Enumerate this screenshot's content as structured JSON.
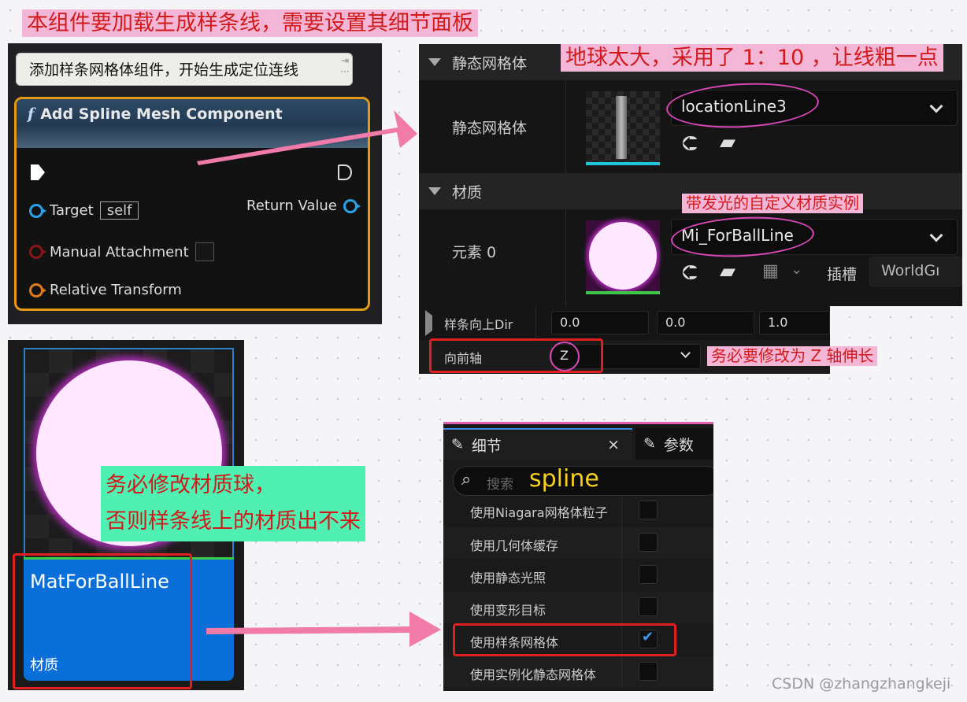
{
  "notes": {
    "top_left": "本组件要加载生成样条线，需要设置其细节面板",
    "top_right": "地球太大，采用了 1：10 ，让线粗一点",
    "material_instance": "带发光的自定义材质实例",
    "forward_axis": "务必要修改为 Z 轴伸长",
    "material_ball_line1": "务必修改材质球，",
    "material_ball_line2": "否则样条线上的材质出不来"
  },
  "blueprint": {
    "comment": "添加样条网格体组件，开始生成定位连线",
    "node_title": "Add Spline Mesh Component",
    "pins": {
      "target": "Target",
      "target_value": "self",
      "manual_attachment": "Manual Attachment",
      "relative_transform": "Relative Transform",
      "return_value": "Return Value"
    }
  },
  "static_mesh_panel": {
    "section_static_mesh": "静态网格体",
    "row_static_mesh": "静态网格体",
    "mesh_value": "locationLine3",
    "section_material": "材质",
    "row_element": "元素 0",
    "material_value": "Mi_ForBallLine",
    "slot_label": "插槽",
    "slot_value": "WorldGı"
  },
  "spline_rows": {
    "spline_up_dir": "样条向上Dir",
    "x": "0.0",
    "y": "0.0",
    "z": "1.0",
    "forward_axis": "向前轴",
    "forward_axis_value": "Z"
  },
  "material_asset": {
    "name": "MatForBallLine",
    "type": "材质"
  },
  "details": {
    "tab_details": "细节",
    "tab_params": "参数",
    "search_placeholder": "搜索",
    "search_value": "spline",
    "rows": [
      {
        "label": "使用Niagara网格体粒子",
        "checked": false
      },
      {
        "label": "使用几何体缓存",
        "checked": false
      },
      {
        "label": "使用静态光照",
        "checked": false
      },
      {
        "label": "使用变形目标",
        "checked": false
      },
      {
        "label": "使用样条网格体",
        "checked": true
      },
      {
        "label": "使用实例化静态网格体",
        "checked": false
      }
    ]
  },
  "watermark": "CSDN @zhangzhangkeji",
  "colors": {
    "highlight_red": "#e02020",
    "node_border": "#e59a16",
    "material_blue": "#0a6fd8",
    "note_pink": "#f4b6d6",
    "note_green": "#4ff0b2",
    "arrow_pink": "#f07aa8"
  }
}
